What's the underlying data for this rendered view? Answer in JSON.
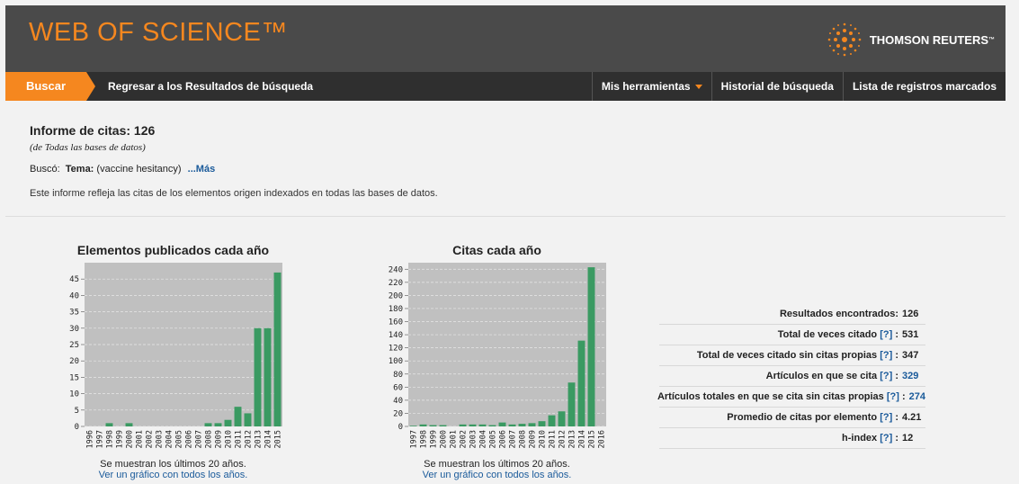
{
  "header": {
    "brand": "WEB OF SCIENCE™",
    "company": "THOMSON REUTERS",
    "company_tm": "™"
  },
  "nav": {
    "search": "Buscar",
    "back": "Regresar a los Resultados de búsqueda",
    "tools": "Mis herramientas",
    "history": "Historial de búsqueda",
    "marked": "Lista de registros marcados"
  },
  "report": {
    "title": "Informe de citas: 126",
    "subtitle": "(de Todas las bases de datos)",
    "searched_label": "Buscó:",
    "topic_label": "Tema:",
    "topic_value": "(vaccine hesitancy)",
    "more": "...Más",
    "note": "Este informe refleja las citas de los elementos origen indexados en todas las bases de datos."
  },
  "chart_data": [
    {
      "type": "bar",
      "title": "Elementos publicados cada año",
      "categories": [
        "1996",
        "1997",
        "1998",
        "1999",
        "2000",
        "2001",
        "2002",
        "2003",
        "2004",
        "2005",
        "2006",
        "2007",
        "2008",
        "2009",
        "2010",
        "2011",
        "2012",
        "2013",
        "2014",
        "2015"
      ],
      "values": [
        0,
        0,
        1,
        0,
        1,
        0,
        0,
        0,
        0,
        0,
        0,
        0,
        1,
        1,
        2,
        6,
        4,
        30,
        30,
        47
      ],
      "ylim": [
        0,
        50
      ],
      "yticks": [
        0,
        5,
        10,
        15,
        20,
        25,
        30,
        35,
        40,
        45
      ],
      "foot": "Se muestran los últimos 20 años.",
      "link": "Ver un gráfico con todos los años."
    },
    {
      "type": "bar",
      "title": "Citas cada año",
      "categories": [
        "1997",
        "1998",
        "1999",
        "2000",
        "2001",
        "2002",
        "2003",
        "2004",
        "2005",
        "2006",
        "2007",
        "2008",
        "2009",
        "2010",
        "2011",
        "2012",
        "2013",
        "2014",
        "2015",
        "2016"
      ],
      "values": [
        1,
        3,
        2,
        2,
        0,
        3,
        3,
        3,
        2,
        6,
        3,
        4,
        5,
        8,
        17,
        23,
        67,
        131,
        243,
        0
      ],
      "ylim": [
        0,
        250
      ],
      "yticks": [
        0,
        20,
        40,
        60,
        80,
        100,
        120,
        140,
        160,
        180,
        200,
        220,
        240
      ],
      "foot": "Se muestran los últimos 20 años.",
      "link": "Ver un gráfico con todos los años."
    }
  ],
  "stats": [
    {
      "label": "Resultados encontrados:",
      "help": "",
      "value": "126",
      "link": false
    },
    {
      "label": "Total de veces citado",
      "help": "[?]",
      "value": "531",
      "link": false
    },
    {
      "label": "Total de veces citado sin citas propias",
      "help": "[?]",
      "value": "347",
      "link": false
    },
    {
      "label": "Artículos en que se cita",
      "help": "[?]",
      "value": "329",
      "link": true
    },
    {
      "label": "Artículos totales en que se cita sin citas propias",
      "help": "[?]",
      "value": "274",
      "link": true
    },
    {
      "label": "Promedio de citas por elemento",
      "help": "[?]",
      "value": "4.21",
      "link": false
    },
    {
      "label": "h-index",
      "help": "[?]",
      "value": "12",
      "link": false
    }
  ],
  "colors": {
    "accent": "#f5871f",
    "bar": "#3a9a62",
    "plot_bg": "#c0c0c0",
    "link": "#1a5a9a"
  }
}
